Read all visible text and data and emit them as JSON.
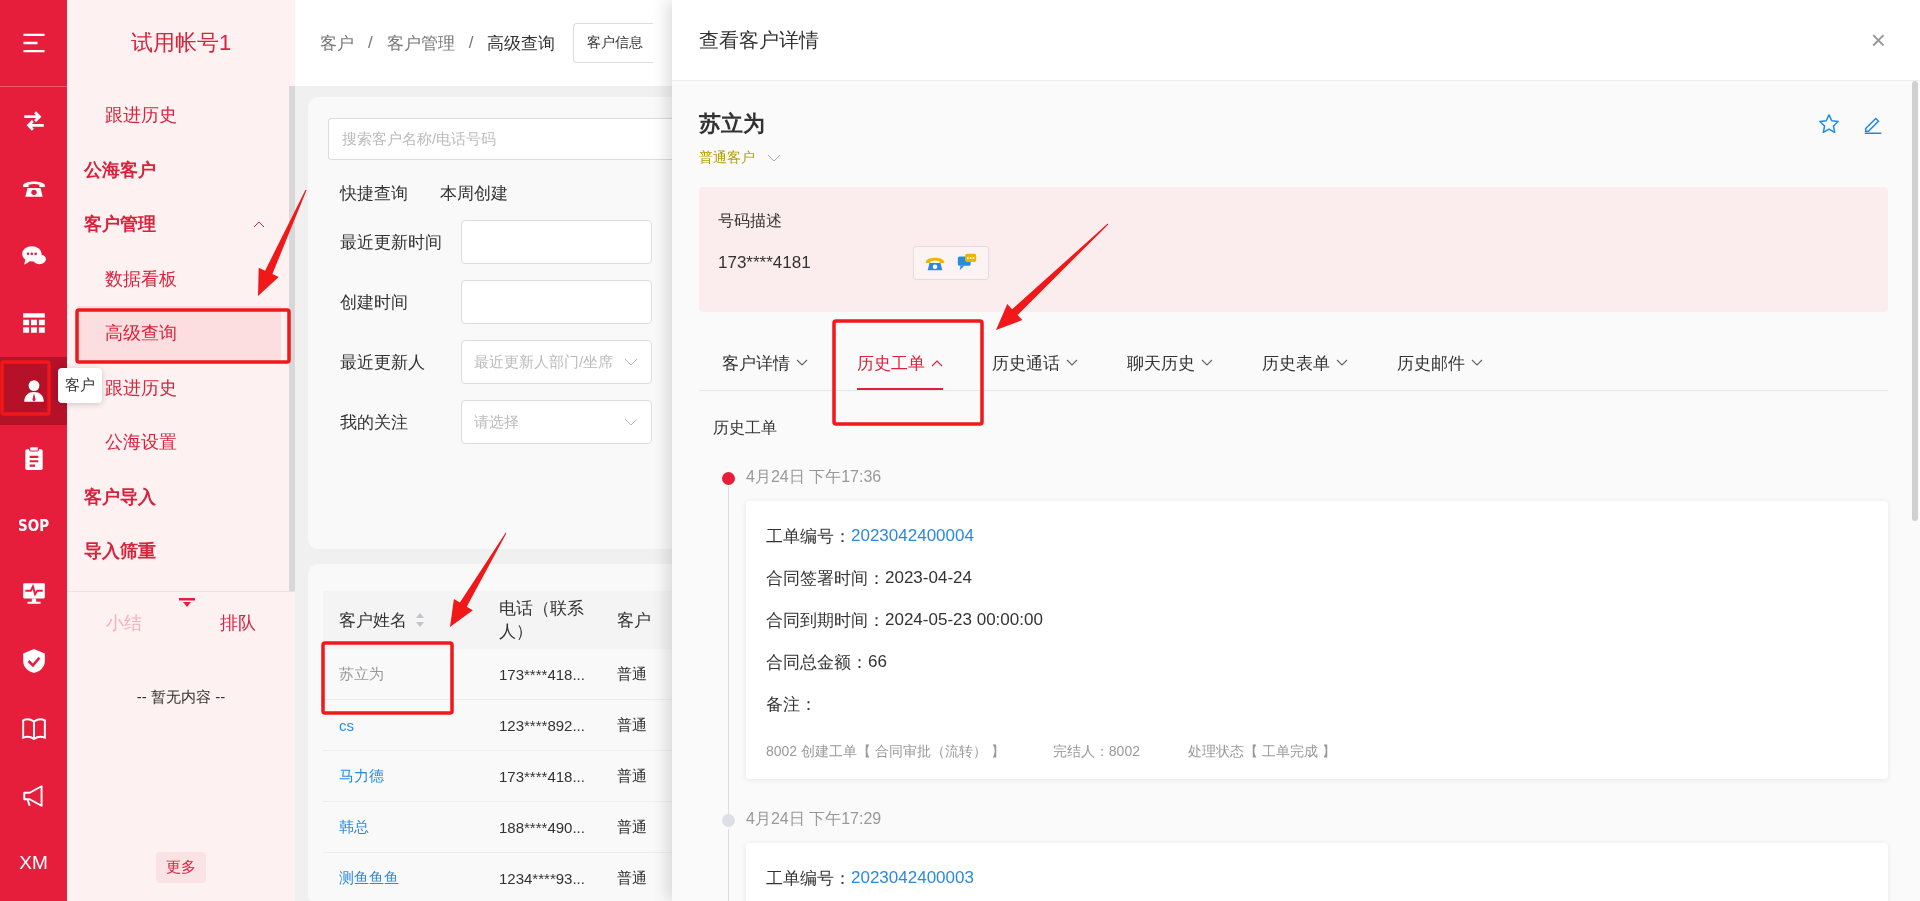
{
  "rail": {
    "items": [
      {
        "selected": false
      },
      {
        "selected": false
      },
      {
        "selected": false
      },
      {
        "selected": false
      },
      {
        "selected": true
      },
      {
        "selected": false
      },
      {
        "label": "SOP",
        "selected": false
      },
      {
        "selected": false
      },
      {
        "selected": false
      },
      {
        "selected": false
      },
      {
        "selected": false
      },
      {
        "label": "XM",
        "selected": false
      }
    ],
    "tooltip": "客户"
  },
  "sidebar": {
    "account": "试用帐号1",
    "menu": [
      {
        "kind": "item",
        "label": "跟进历史",
        "selected": false
      },
      {
        "kind": "group",
        "label": "公海客户"
      },
      {
        "kind": "group",
        "label": "客户管理",
        "expanded": true,
        "children": [
          {
            "kind": "item",
            "label": "数据看板",
            "selected": false
          },
          {
            "kind": "item",
            "label": "高级查询",
            "selected": true
          },
          {
            "kind": "item",
            "label": "跟进历史",
            "selected": false
          },
          {
            "kind": "item",
            "label": "公海设置",
            "selected": false
          }
        ]
      },
      {
        "kind": "group",
        "label": "客户导入"
      },
      {
        "kind": "group",
        "label": "导入筛重"
      }
    ],
    "panel_tabs": [
      {
        "label": "小结",
        "selected": false
      },
      {
        "label": "排队",
        "selected": true
      }
    ],
    "empty_text": "-- 暂无内容 --",
    "more_button": "更多"
  },
  "main": {
    "breadcrumb": [
      {
        "label": "客户"
      },
      {
        "label": "客户管理"
      },
      {
        "label": "高级查询"
      }
    ],
    "separators": [
      "/",
      "/"
    ],
    "header_select": {
      "value": "客户信息"
    },
    "search": {
      "placeholder": "搜索客户名称/电话号码"
    },
    "quick_query": {
      "label": "快捷查询",
      "options": [
        "本周创建"
      ]
    },
    "filters": [
      {
        "kind": "input",
        "label": "最近更新时间"
      },
      {
        "kind": "input",
        "label": "创建时间"
      },
      {
        "kind": "select",
        "label": "最近更新人",
        "placeholder": "最近更新人部门/坐席"
      },
      {
        "kind": "select",
        "label": "我的关注",
        "placeholder": "请选择"
      }
    ],
    "table": {
      "columns": [
        {
          "label": "客户姓名",
          "sortable": true
        },
        {
          "label": "电话（联系人）"
        },
        {
          "label": "客户"
        }
      ],
      "rows": [
        {
          "selected": true,
          "cells": [
            "苏立为",
            "173****418...",
            "普通"
          ]
        },
        {
          "selected": false,
          "cells": [
            "cs",
            "123****892...",
            "普通"
          ]
        },
        {
          "selected": false,
          "cells": [
            "马力德",
            "173****418...",
            "普通"
          ]
        },
        {
          "selected": false,
          "cells": [
            "韩总",
            "188****490...",
            "普通"
          ]
        },
        {
          "selected": false,
          "cells": [
            "测鱼鱼鱼",
            "1234****93...",
            "普通"
          ]
        }
      ]
    }
  },
  "drawer": {
    "title": "查看客户详情",
    "close": "×",
    "customer": {
      "name": "苏立为",
      "type": "普通客户"
    },
    "phone_panel": {
      "label": "号码描述",
      "number": "173****4181"
    },
    "tabs": [
      {
        "label": "客户详情",
        "selected": false
      },
      {
        "label": "历史工单",
        "selected": true
      },
      {
        "label": "历史通话",
        "selected": false
      },
      {
        "label": "聊天历史",
        "selected": false
      },
      {
        "label": "历史表单",
        "selected": false
      },
      {
        "label": "历史邮件",
        "selected": false
      }
    ],
    "section_title": "历史工单",
    "timeline": [
      {
        "time": "4月24日 下午17:36",
        "active": true,
        "fields": [
          {
            "label": "工单编号：",
            "value": "2023042400004",
            "kind": "link"
          },
          {
            "label": "合同签署时间：",
            "value": "2023-04-24",
            "kind": "text"
          },
          {
            "label": "合同到期时间：",
            "value": "2024-05-23 00:00:00",
            "kind": "text"
          },
          {
            "label": "合同总金额：",
            "value": "66",
            "kind": "text"
          },
          {
            "label": "备注：",
            "kind": "text"
          }
        ],
        "footer": [
          "8002 创建工单【 合同审批（流转） 】",
          "完结人：8002",
          "处理状态【 工单完成 】"
        ]
      },
      {
        "time": "4月24日 下午17:29",
        "active": false,
        "fields": [
          {
            "label": "工单编号：",
            "value": "2023042400003",
            "kind": "link"
          }
        ]
      }
    ]
  }
}
